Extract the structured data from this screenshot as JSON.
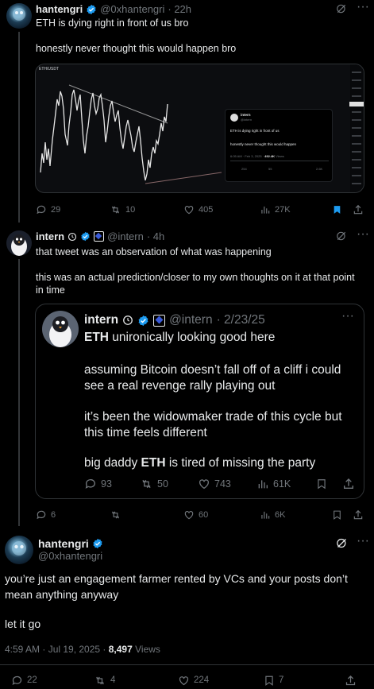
{
  "post1": {
    "author": "hantengri",
    "handle": "@0xhantengri",
    "time": "· 22h",
    "line1": "ETH is dying right in front of us bro",
    "line2": "honestly never thought this would happen bro",
    "stats": {
      "replies": "29",
      "reposts": "10",
      "likes": "405",
      "views": "27K"
    },
    "image": {
      "pair": "ETH/USDT",
      "embedded_tweet": {
        "author": "intern",
        "handle": "@intern",
        "line1": "ETH is dying right in front of us",
        "line2": "honestly never thought this would happen",
        "meta_time": "6:05 AM · Feb 3, 2025 ·",
        "meta_views": "492.4K",
        "meta_views_label": "Views",
        "s_replies": "254",
        "s_reposts": "55",
        "s_likes": "2.6K"
      }
    }
  },
  "post2": {
    "author": "intern",
    "handle": "@intern",
    "time": "· 4h",
    "line1": "that tweet was an observation of what was happening",
    "line2": "this was an actual prediction/closer to my own thoughts on it at that point",
    "line3": "in time",
    "stats": {
      "replies": "6",
      "likes": "60",
      "views": "6K"
    },
    "quote": {
      "author": "intern",
      "handle": "@intern",
      "date": "· 2/23/25",
      "line1_pre": "ETH",
      "line1_post": " unironically looking good here",
      "line2": "assuming Bitcoin doesn’t fall off of a cliff i could",
      "line3": "see a real revenge rally playing out",
      "line4": "it’s been the widowmaker trade of this cycle but",
      "line5": "this time feels different",
      "line6_pre": "big daddy ",
      "line6_bold": "ETH",
      "line6_post": " is tired of missing the party",
      "stats": {
        "replies": "93",
        "reposts": "50",
        "likes": "743",
        "views": "61K"
      }
    }
  },
  "post3": {
    "author": "hantengri",
    "handle": "@0xhantengri",
    "line1": "you’re just an engagement farmer rented by VCs and your posts don’t",
    "line2": "mean anything anyway",
    "line3": "let it go",
    "meta_time": "4:59 AM · Jul 19, 2025 ·",
    "meta_views": "8,497",
    "meta_views_label": "Views",
    "stats": {
      "replies": "22",
      "reposts": "4",
      "likes": "224",
      "bookmarks": "7"
    }
  },
  "colors": {
    "accent": "#1d9bf0",
    "bg": "#000000",
    "muted": "#71767b",
    "border": "#2f3336"
  }
}
